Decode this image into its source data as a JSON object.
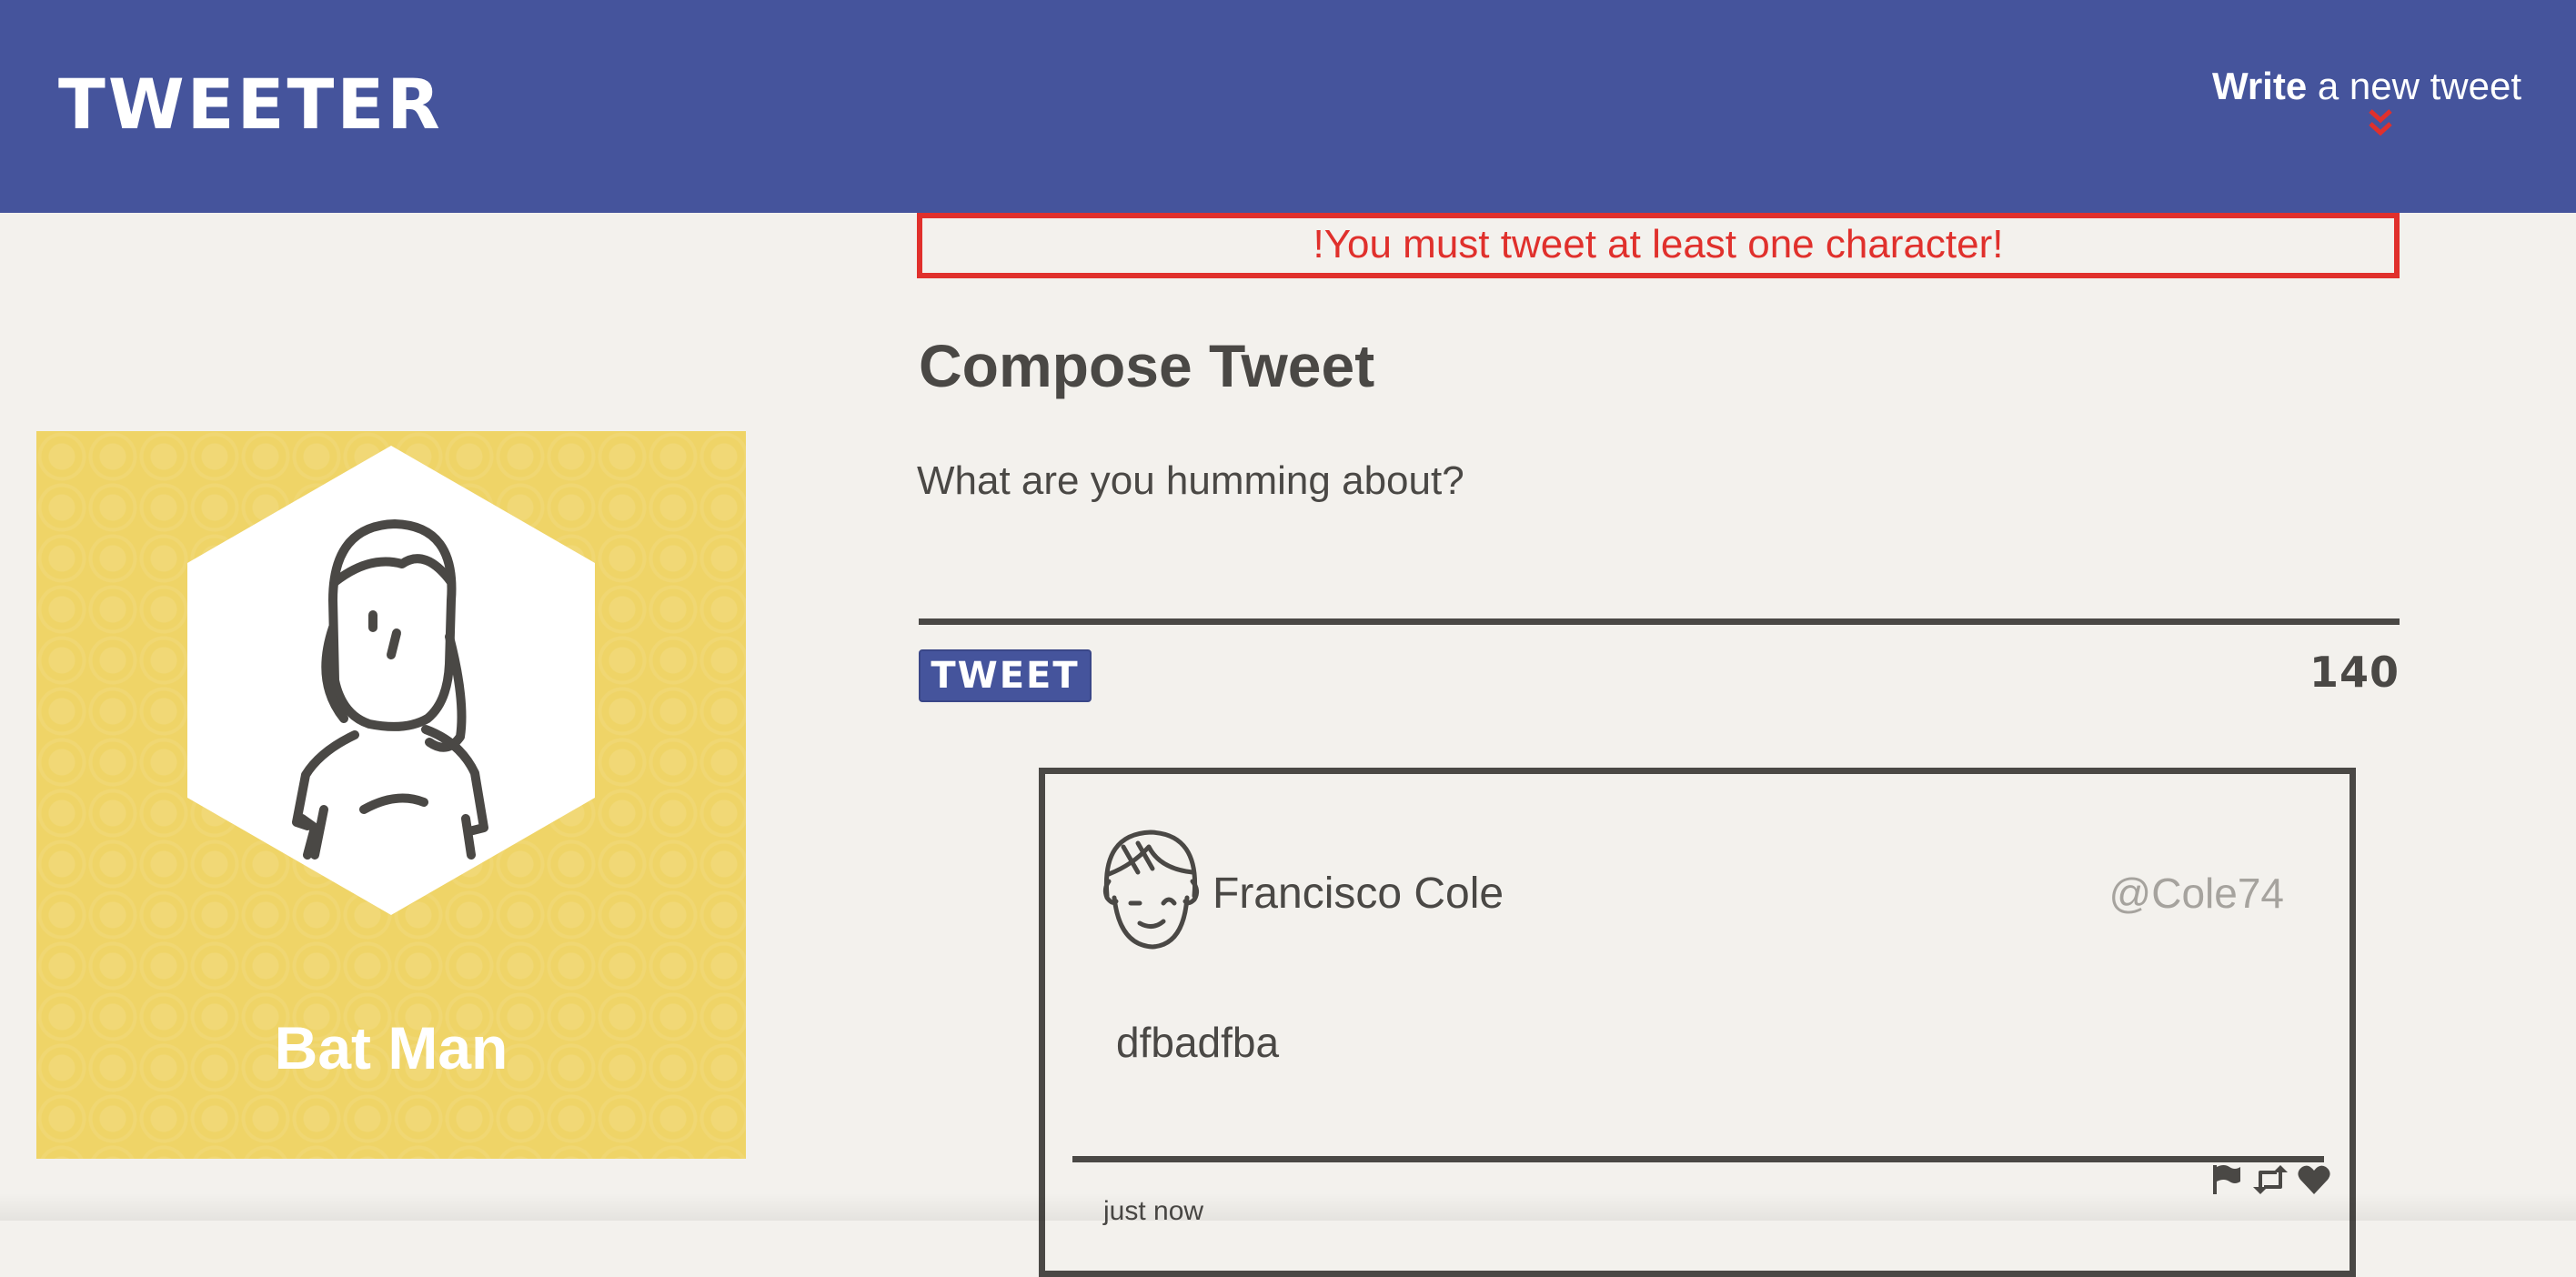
{
  "nav": {
    "logo": "TWEETER",
    "write_bold": "Write",
    "write_rest": "a new tweet"
  },
  "profile": {
    "name": "Bat Man"
  },
  "error": {
    "message": "!You must tweet at least one character!"
  },
  "compose": {
    "title": "Compose Tweet",
    "placeholder": "What are you humming about?",
    "submit_label": "TWEET",
    "counter": "140"
  },
  "tweets": [
    {
      "author": "Francisco Cole",
      "handle": "@Cole74",
      "text": "dfbadfba",
      "time": "just now",
      "actions": [
        "flag-icon",
        "retweet-icon",
        "heart-icon"
      ]
    }
  ],
  "colors": {
    "nav_bg": "#45549c",
    "profile_bg": "#efd467",
    "error": "#e0302c",
    "text": "#4a4845",
    "page_bg": "#f3f1ed"
  }
}
